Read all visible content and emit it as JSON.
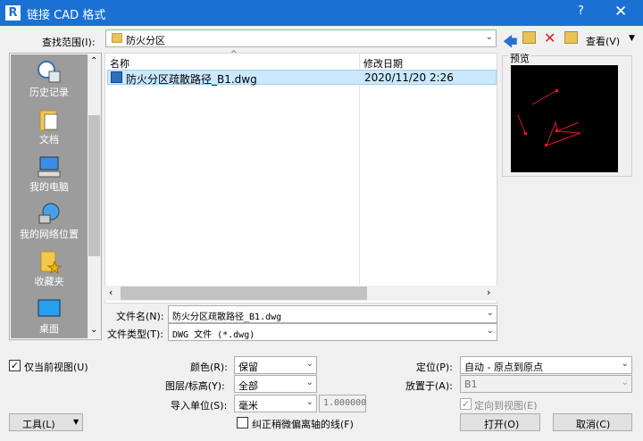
{
  "dialog": {
    "title": "链接 CAD 格式",
    "logo": "R",
    "help": "?",
    "close": "✕"
  },
  "lookin": {
    "label": "查找范围(I):",
    "value": "防火分区",
    "views_label": "查看(V)"
  },
  "places": [
    {
      "label": "历史记录",
      "icon": "history-icon"
    },
    {
      "label": "文档",
      "icon": "documents-icon"
    },
    {
      "label": "我的电脑",
      "icon": "computer-icon"
    },
    {
      "label": "我的网络位置",
      "icon": "network-icon"
    },
    {
      "label": "收藏夹",
      "icon": "favorites-icon"
    },
    {
      "label": "桌面",
      "icon": "desktop-icon"
    }
  ],
  "filelist": {
    "col_name": "名称",
    "col_date": "修改日期",
    "rows": [
      {
        "name": "防火分区疏散路径_B1.dwg",
        "date": "2020/11/20 2:26"
      }
    ]
  },
  "preview": {
    "label": "预览"
  },
  "filename": {
    "label": "文件名(N):",
    "value": "防火分区疏散路径_B1.dwg"
  },
  "filetype": {
    "label": "文件类型(T):",
    "value": "DWG 文件 (*.dwg)"
  },
  "options": {
    "current_view_only": {
      "label": "仅当前视图(U)",
      "checked": true
    },
    "colors": {
      "label": "颜色(R):",
      "value": "保留"
    },
    "layers": {
      "label": "图层/标高(Y):",
      "value": "全部"
    },
    "import_units": {
      "label": "导入单位(S):",
      "value": "毫米",
      "scale": "1.000000"
    },
    "correct_lines": {
      "label": "纠正稍微偏离轴的线(F)",
      "checked": false
    },
    "positioning": {
      "label": "定位(P):",
      "value": "自动 - 原点到原点"
    },
    "place_at": {
      "label": "放置于(A):",
      "value": "B1"
    },
    "orient_to_view": {
      "label": "定向到视图(E)",
      "checked": true
    }
  },
  "buttons": {
    "tools": "工具(L)",
    "open": "打开(O)",
    "cancel": "取消(C)"
  }
}
